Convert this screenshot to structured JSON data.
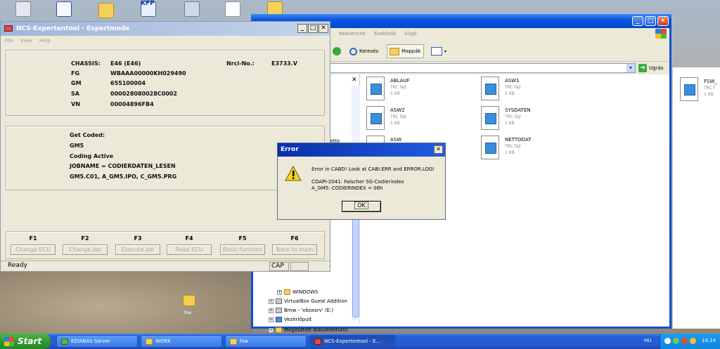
{
  "desktop": {
    "icon_text": "KFP",
    "bottom_icon_label": "fsw"
  },
  "explorer": {
    "menu": [
      "Kedvencek",
      "Eszközök",
      "Súgó"
    ],
    "toolbar": {
      "search_label": "Keresés",
      "folders_label": "Mappák"
    },
    "go_label": "Ugrás",
    "tree_fragment": "d Settir",
    "tree_items": [
      {
        "label": "WINDOWS",
        "icon": "folder-icon"
      },
      {
        "label": "VirtualBox Guest Addition",
        "icon": "drive-icon"
      },
      {
        "label": "Bmw - 'vboxsrv' (E:)",
        "icon": "drive-icon"
      },
      {
        "label": "Vezérlőpult",
        "icon": "panel-icon"
      },
      {
        "label": "Megosztott dokumentumc",
        "icon": "folder-icon"
      }
    ],
    "files": [
      {
        "name": "ABLAUF",
        "type": "TRC fájl",
        "size": "1 KB"
      },
      {
        "name": "ASW1",
        "type": "TRC fájl",
        "size": "1 KB"
      },
      {
        "name": "ASW2",
        "type": "TRC fájl",
        "size": "1 KB"
      },
      {
        "name": "SYSDATEN",
        "type": "TRC fájl",
        "size": "1 KB"
      },
      {
        "name": "ASW",
        "type": "",
        "size": ""
      },
      {
        "name": "NETTODAT",
        "type": "TRC fájl",
        "size": "1 KB"
      }
    ]
  },
  "explorer2": {
    "file": {
      "name": "FSW_",
      "type": "TRC f",
      "size": "1 KB"
    }
  },
  "ncs": {
    "title": "NCS-Expertentool - Expertmode",
    "menu": [
      "File",
      "View",
      "Help"
    ],
    "vehicle": {
      "chassis_label": "CHASSIS:",
      "chassis_value": "E46 (E46)",
      "nrcl_label": "Nrcl-No.:",
      "nrcl_value": "E3733.V",
      "fg_label": "FG",
      "fg_value": "WBAAA00000KH029490",
      "gm_label": "GM",
      "gm_value": "655100004",
      "sa_label": "SA",
      "sa_value": "000028080028C0002",
      "vn_label": "VN",
      "vn_value": "00004896FB4"
    },
    "coding": {
      "line1": "Get Coded:",
      "line2": "GM5",
      "line3": "Coding Active",
      "line4": "JOBNAME = CODIERDATEN_LESEN",
      "line5": "GM5.C01, A_GM5.IPO, C_GM5.PRG"
    },
    "functions": [
      {
        "key": "F1",
        "label": "Change ECU"
      },
      {
        "key": "F2",
        "label": "Change job"
      },
      {
        "key": "F3",
        "label": "Execute job"
      },
      {
        "key": "F4",
        "label": "Read ECU"
      },
      {
        "key": "F5",
        "label": "Basic function"
      },
      {
        "key": "F6",
        "label": "Back to main"
      }
    ],
    "status": "Ready",
    "cap": "CAP"
  },
  "error": {
    "title": "Error",
    "message": "Error in CABD! Look at CABI.ERR and ERROR.LOG!",
    "detail1": "COAPI-2041: Falscher SG-Codierindex",
    "detail2": "A_GM5: CODIERINDEX = 06h",
    "ok_label": "OK"
  },
  "taskbar": {
    "start_label": "Start",
    "tasks": [
      {
        "label": "EDIABAS Server",
        "icon": "server-icon"
      },
      {
        "label": "WORK",
        "icon": "folder-icon"
      },
      {
        "label": "fsw",
        "icon": "folder-icon"
      },
      {
        "label": "NCS-Expertentool - E...",
        "icon": "app-icon"
      }
    ],
    "lang": "HU",
    "time": "14:14"
  }
}
